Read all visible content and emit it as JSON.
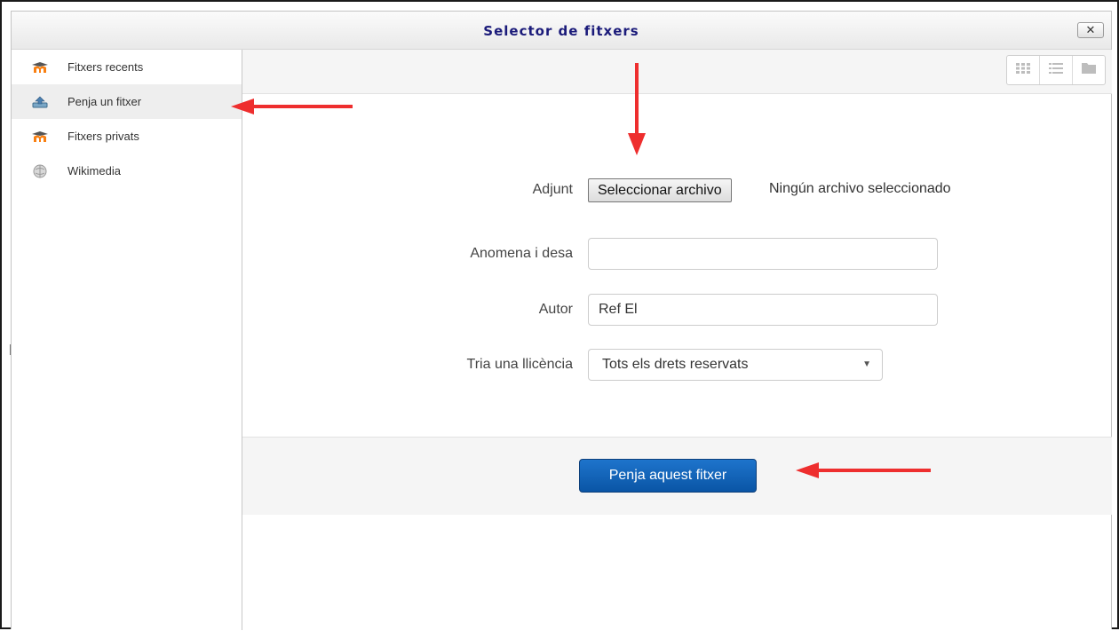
{
  "dialog": {
    "title": "Selector de fitxers",
    "close_label": "✕"
  },
  "sidebar": {
    "items": [
      {
        "label": "Fitxers recents",
        "icon": "moodle-icon",
        "active": false
      },
      {
        "label": "Penja un fitxer",
        "icon": "upload-icon",
        "active": true
      },
      {
        "label": "Fitxers privats",
        "icon": "moodle-icon",
        "active": false
      },
      {
        "label": "Wikimedia",
        "icon": "wikimedia-icon",
        "active": false
      }
    ]
  },
  "toolbar": {
    "view_buttons": [
      "icons-view-icon",
      "list-view-icon",
      "tree-view-icon"
    ]
  },
  "form": {
    "attachment_label": "Adjunt",
    "file_button_label": "Seleccionar archivo",
    "file_status": "Ningún archivo seleccionado",
    "save_as_label": "Anomena i desa",
    "save_as_value": "",
    "author_label": "Autor",
    "author_value": "Ref El",
    "license_label": "Tria una llicència",
    "license_selected": "Tots els drets reservats"
  },
  "footer": {
    "upload_button_label": "Penja aquest fitxer"
  },
  "colors": {
    "title": "#1b1b7a",
    "primary_button": "#0a55a5",
    "annotation_arrow": "#ee2e2e",
    "moodle_orange": "#f98012"
  }
}
